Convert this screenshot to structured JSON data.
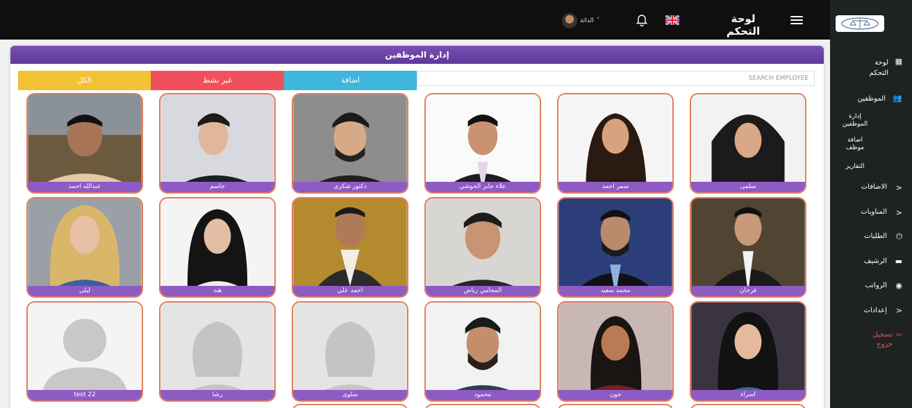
{
  "topbar": {
    "title": "لوحة التحكم",
    "user_label": "الدائة"
  },
  "sidebar": {
    "items": [
      {
        "label": "لوحة التحكم"
      },
      {
        "label": "الموظفين"
      },
      {
        "label": "إدارة الموظفين"
      },
      {
        "label": "اضافة موظف"
      },
      {
        "label": "التقارير"
      },
      {
        "label": "الاضافات"
      },
      {
        "label": "المناوبات"
      },
      {
        "label": "الطلبات"
      },
      {
        "label": "الرشيف"
      },
      {
        "label": "الرواتب"
      },
      {
        "label": "إعدادات"
      },
      {
        "label": "تسجيل خروج"
      }
    ]
  },
  "panel": {
    "title": "إدارة الموظفين",
    "search_placeholder": "SEARCH EMPLOYEE",
    "tabs": {
      "add": "اضافة",
      "inactive": "غير نشط",
      "all": "الكل"
    }
  },
  "employees": [
    {
      "name": "سلمى"
    },
    {
      "name": "سمر احمد"
    },
    {
      "name": "علاء جابر الحوشي"
    },
    {
      "name": "دكتور شكري"
    },
    {
      "name": "جاسم"
    },
    {
      "name": "عبدالله احمد"
    },
    {
      "name": "فرحان"
    },
    {
      "name": "محمد سعيد"
    },
    {
      "name": "المحامي رياض"
    },
    {
      "name": "احمد علي"
    },
    {
      "name": "هند"
    },
    {
      "name": "ليلى"
    },
    {
      "name": "اسراء"
    },
    {
      "name": "جون"
    },
    {
      "name": "محمود"
    },
    {
      "name": "سلوى"
    },
    {
      "name": "رشا"
    },
    {
      "name": "test 22"
    }
  ],
  "colors": {
    "tab_add": "#3fb6dc",
    "tab_inactive": "#f0505a",
    "tab_all": "#f1c232",
    "card_border": "#e27d5b",
    "caption": "#8e5bc4"
  }
}
